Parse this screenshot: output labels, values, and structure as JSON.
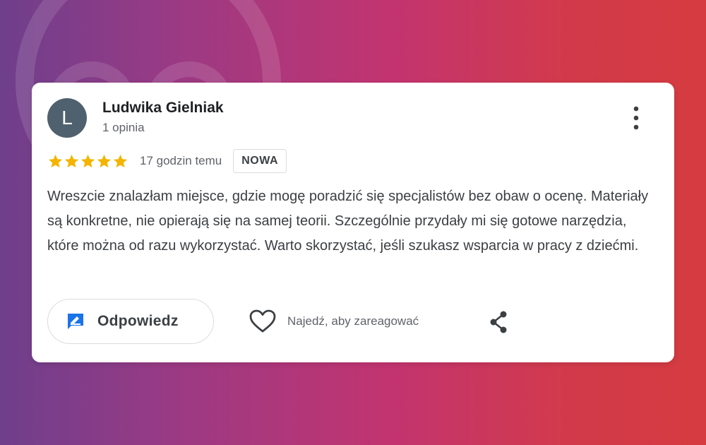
{
  "reviewer": {
    "initial": "L",
    "name": "Ludwika Gielniak",
    "meta": "1 opinia"
  },
  "rating": {
    "stars": 5,
    "max_stars": 5,
    "time": "17 godzin temu",
    "badge": "NOWA"
  },
  "review": {
    "text": "Wreszcie znalazłam miejsce, gdzie mogę poradzić się specjalistów bez obaw o ocenę. Materiały są konkretne, nie opierają się na samej teorii. Szczególnie przydały mi się gotowe narzędzia, które można od razu wykorzystać. Warto skorzystać, jeśli szukasz wsparcia w pracy z dziećmi."
  },
  "actions": {
    "reply_label": "Odpowiedz",
    "react_label": "Najedź, aby zareagować"
  },
  "icons": {
    "more": "more-vert-icon",
    "star": "star-icon",
    "reply": "reply-icon",
    "heart": "heart-icon",
    "share": "share-icon"
  },
  "colors": {
    "star": "#f4b400",
    "reply_icon": "#1a73e8",
    "avatar_bg": "#4f616e",
    "gradient_start": "#6e3f8c",
    "gradient_end": "#d53b3f"
  }
}
